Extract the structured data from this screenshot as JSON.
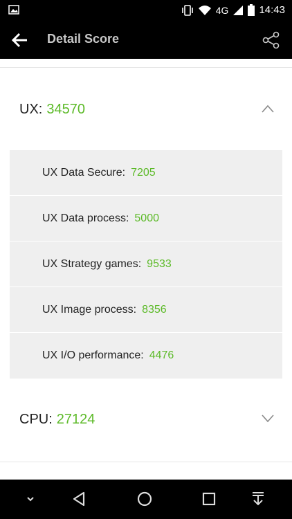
{
  "status_bar": {
    "network": "4G",
    "time": "14:43"
  },
  "app_bar": {
    "title": "Detail Score"
  },
  "colors": {
    "score_green": "#5cba28",
    "sub_panel_bg": "#efefef"
  },
  "sections": [
    {
      "label": "UX:",
      "score": "34570",
      "expanded": true,
      "items": [
        {
          "label": "UX Data Secure:",
          "value": "7205"
        },
        {
          "label": "UX Data process:",
          "value": "5000"
        },
        {
          "label": "UX Strategy games:",
          "value": "9533"
        },
        {
          "label": "UX Image process:",
          "value": "8356"
        },
        {
          "label": "UX I/O performance:",
          "value": "4476"
        }
      ]
    },
    {
      "label": "CPU:",
      "score": "27124",
      "expanded": false
    }
  ]
}
